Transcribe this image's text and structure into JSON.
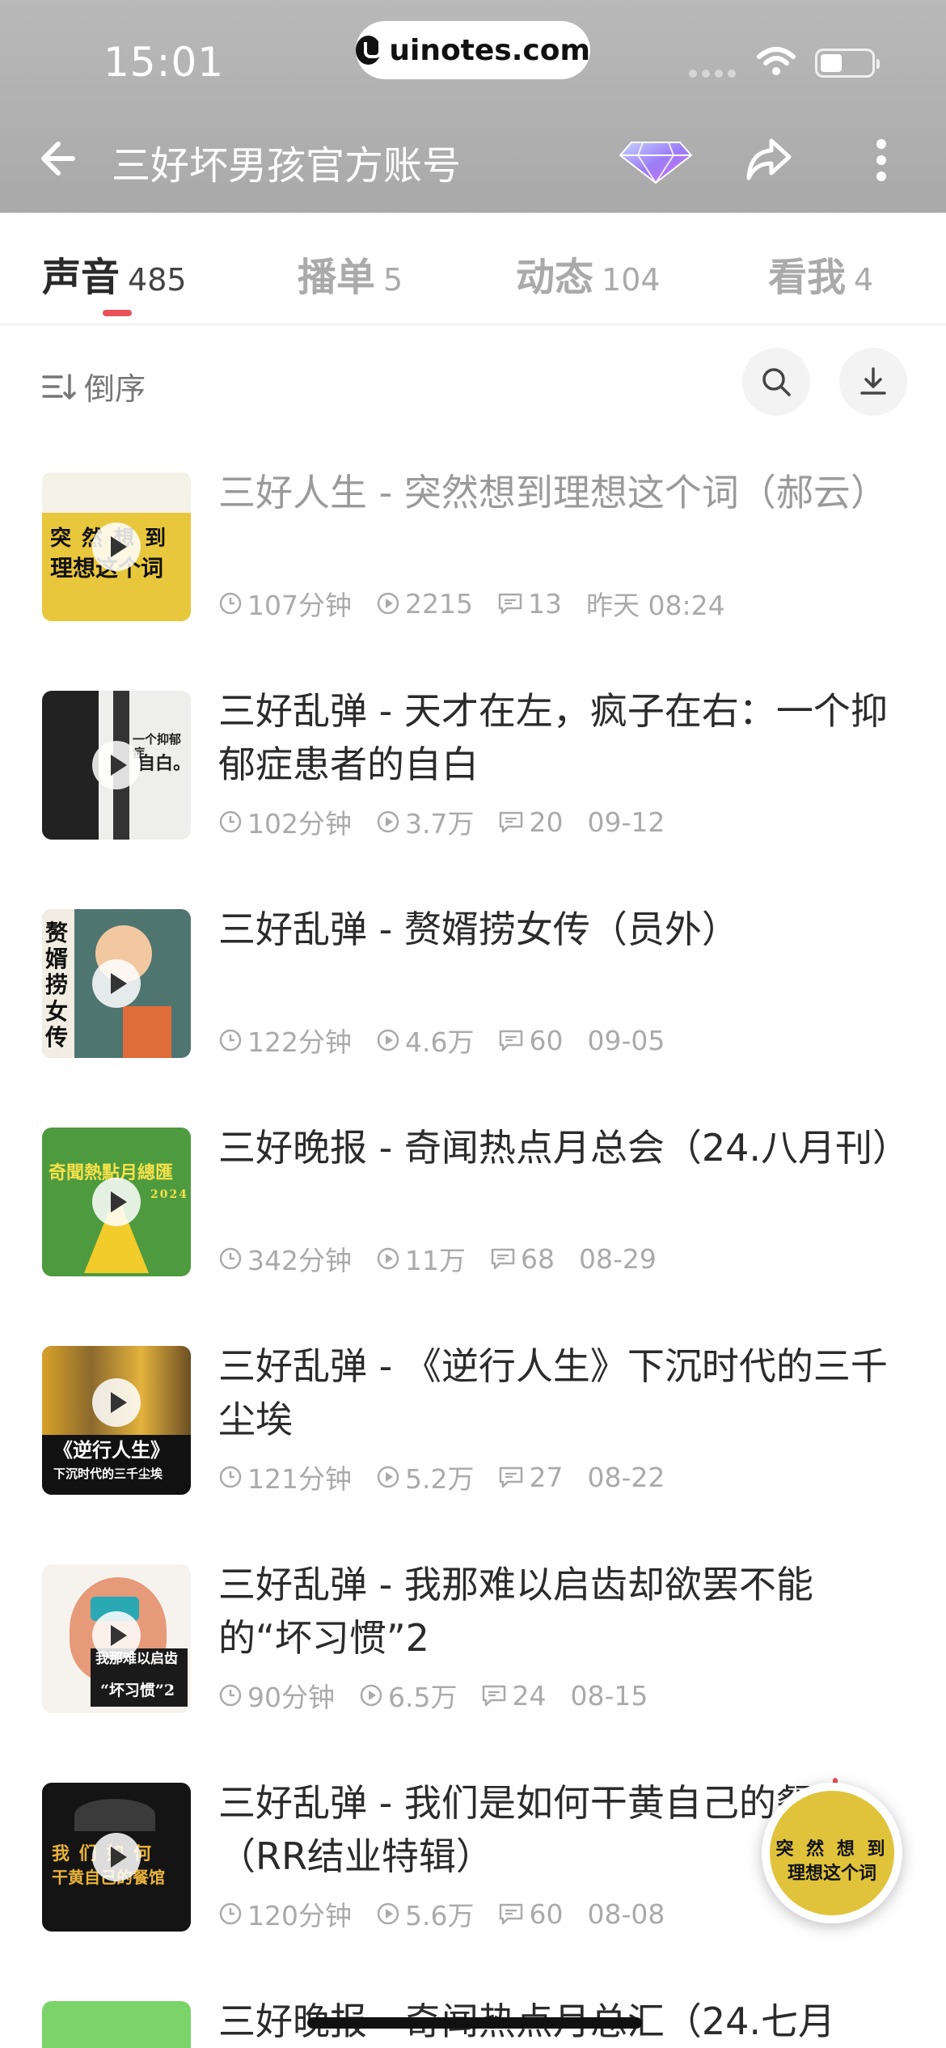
{
  "status_bar": {
    "time": "15:01",
    "url": "uinotes.com"
  },
  "header": {
    "title": "三好坏男孩官方账号"
  },
  "tabs": [
    {
      "label": "声音",
      "count": "485",
      "active": true
    },
    {
      "label": "播单",
      "count": "5"
    },
    {
      "label": "动态",
      "count": "104"
    },
    {
      "label": "看我",
      "count": "4"
    }
  ],
  "toolbar": {
    "sort_label": "倒序"
  },
  "episodes": [
    {
      "title": "三好人生 - 突然想到理想这个词（郝云）",
      "duration": "107分钟",
      "plays": "2215",
      "comments": "13",
      "date": "昨天 08:24",
      "played": true,
      "cover": {
        "line1": "突 然 想 到",
        "line2": "理想这个词"
      }
    },
    {
      "title": "三好乱弹 - 天才在左，疯子在右：一个抑郁症患者的自白",
      "duration": "102分钟",
      "plays": "3.7万",
      "comments": "20",
      "date": "09-12",
      "cover": {
        "line1": "一个抑郁症",
        "line2": "自白。"
      }
    },
    {
      "title": "三好乱弹 - 赘婿捞女传（员外）",
      "duration": "122分钟",
      "plays": "4.6万",
      "comments": "60",
      "date": "09-05",
      "cover": {
        "line1": "赘婿捞女传"
      }
    },
    {
      "title": "三好晚报 - 奇闻热点月总会（24.八月刊）",
      "duration": "342分钟",
      "plays": "11万",
      "comments": "68",
      "date": "08-29",
      "cover": {
        "line1": "奇聞熱點月總匯",
        "line2": "2024"
      }
    },
    {
      "title": "三好乱弹 - 《逆行人生》下沉时代的三千尘埃",
      "duration": "121分钟",
      "plays": "5.2万",
      "comments": "27",
      "date": "08-22",
      "cover": {
        "line1": "《逆行人生》",
        "line2": "下沉时代的三千尘埃"
      }
    },
    {
      "title": "三好乱弹 - 我那难以启齿却欲罢不能的“坏习惯”2",
      "duration": "90分钟",
      "plays": "6.5万",
      "comments": "24",
      "date": "08-15",
      "cover": {
        "line1": "我那难以启齿",
        "line2": "“坏习惯”2"
      }
    },
    {
      "title": "三好乱弹 - 我们是如何干黄自己的餐馆（RR结业特辑）",
      "duration": "120分钟",
      "plays": "5.6万",
      "comments": "60",
      "date": "08-08",
      "cover": {
        "line1": "我 们 如 何",
        "line2": "干黄自己的餐馆"
      }
    },
    {
      "title": "三好晚报 - 奇闻热点月总汇（24.七月",
      "partial": true
    }
  ],
  "float_player": {
    "line1": "突 然 想 到",
    "line2": "理想这个词"
  },
  "colors": {
    "accent": "#e9525a",
    "header_bg": "#b0b0b0"
  }
}
